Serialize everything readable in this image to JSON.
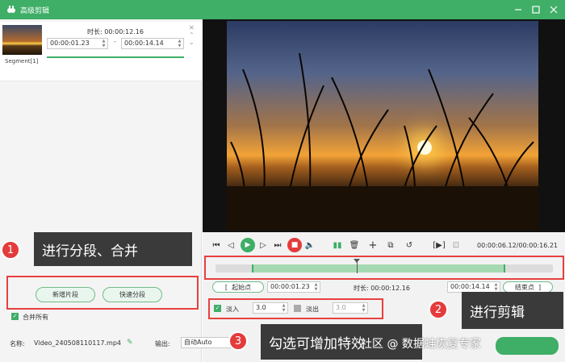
{
  "window": {
    "title": "高级剪辑"
  },
  "segment": {
    "label": "Segment[1]",
    "duration_label": "时长:",
    "duration": "00:00:12.16",
    "start": "00:00:01.23",
    "end": "00:00:14.14",
    "dash": "-",
    "close_symbol": "✕"
  },
  "tips": {
    "tip1": {
      "num": "1",
      "text": "进行分段、合并"
    },
    "tip2": {
      "num": "2",
      "text": "进行剪辑"
    },
    "tip3": {
      "num": "3",
      "text": "勾选可增加特效"
    }
  },
  "left_buttons": {
    "new_segment": "新增片段",
    "quick_split": "快速分段"
  },
  "merge_all": {
    "label": "合并所有",
    "checked": true
  },
  "player": {
    "current_time": "00:00:06.12",
    "total_time": "00:00:16.21",
    "time_separator": "/"
  },
  "trim": {
    "start_label": "起始点",
    "start_value": "00:00:01.23",
    "duration_label": "时长:",
    "duration_value": "00:00:12.16",
    "end_value": "00:00:14.14",
    "end_label": "结束点",
    "open_bracket": "[",
    "close_bracket": "]"
  },
  "effects": {
    "fade_in_label": "淡入",
    "fade_in_value": "3.0",
    "fade_in_checked": true,
    "fade_out_label": "淡出",
    "fade_out_value": "3.0",
    "fade_out_checked": false
  },
  "bottom": {
    "name_label": "名称:",
    "filename": "Video_240508110117.mp4",
    "output_label": "输出:",
    "output_value": "自动Auto"
  },
  "watermark": "社区 @ 数据蛙恢复专家",
  "colors": {
    "accent": "#3fae67",
    "highlight": "#e74040",
    "tooltip": "#3a3a3a"
  }
}
